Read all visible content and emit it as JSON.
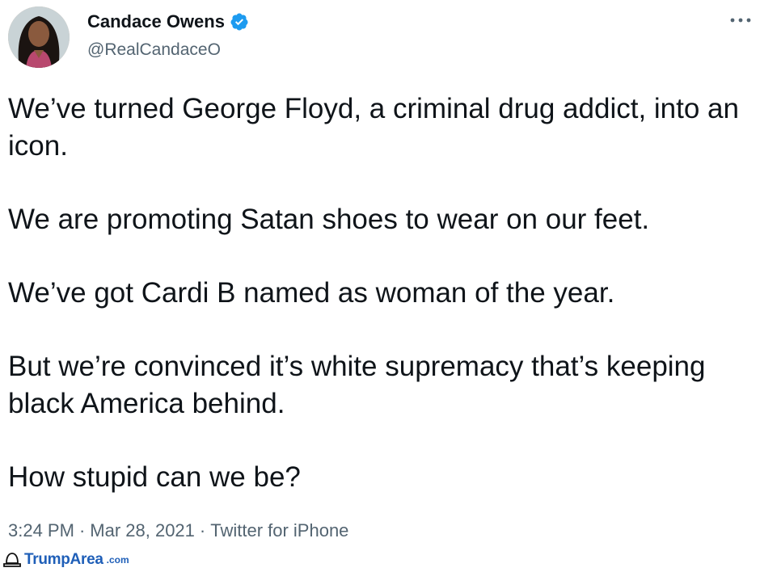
{
  "tweet": {
    "author": {
      "display_name": "Candace Owens",
      "handle": "@RealCandaceO",
      "verified": true
    },
    "paragraphs": [
      "We’ve turned George Floyd, a criminal drug addict, into an icon.",
      "We are promoting Satan shoes to wear on our feet.",
      "We’ve got Cardi B named as woman of the year.",
      "But we’re convinced it’s white supremacy that’s keeping black America behind.",
      "How stupid can we be?"
    ],
    "meta": {
      "time": "3:24 PM",
      "separator": "·",
      "date": "Mar 28, 2021",
      "source": "Twitter for iPhone"
    },
    "more_icon": "more-horizontal-icon",
    "verified_icon": "verified-badge-icon"
  },
  "watermark": {
    "text": "TrumpArea",
    "suffix": ".com"
  },
  "colors": {
    "text_primary": "#0f1419",
    "text_secondary": "#536471",
    "verified_blue": "#1d9bf0",
    "watermark_blue": "#1f5fb8"
  }
}
